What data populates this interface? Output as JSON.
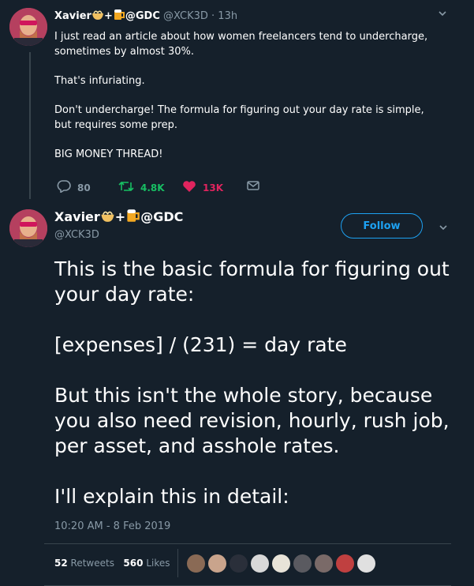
{
  "tweet1": {
    "author_name": "Xavier",
    "author_suffix": "@GDC",
    "handle": "@XCK3D",
    "separator": "·",
    "time": "13h",
    "paragraphs": [
      "I just read an article about how women freelancers tend to undercharge, sometimes by almost 30%.",
      "That's infuriating.",
      "Don't undercharge! The formula for figuring out your day rate is simple, but requires some prep.",
      "BIG MONEY THREAD!"
    ],
    "replies": "80",
    "retweets": "4.8K",
    "likes": "13K"
  },
  "tweet2": {
    "author_name": "Xavier",
    "author_suffix": "@GDC",
    "handle": "@XCK3D",
    "follow_label": "Follow",
    "paragraphs": [
      "This is the basic formula for figuring out your day rate:",
      "[expenses] / (231) = day rate",
      "But this isn't the whole story, because you also need revision, hourly, rush job, per asset, and asshole rates.",
      "I'll explain this in detail:"
    ],
    "timestamp": "10:20 AM - 8 Feb 2019",
    "retweet_count": "52",
    "retweet_label": "Retweets",
    "like_count": "560",
    "like_label": "Likes"
  },
  "colors": {
    "background": "#15202b",
    "text": "#ffffff",
    "muted": "#8899a6",
    "accent": "#1da1f2",
    "retweet": "#17bf63",
    "like": "#e0245e",
    "divider": "#38444d"
  },
  "icons": [
    "reply-icon",
    "retweet-icon",
    "heart-icon",
    "message-icon",
    "chevron-down-icon",
    "noodle-emoji",
    "beer-emoji"
  ]
}
